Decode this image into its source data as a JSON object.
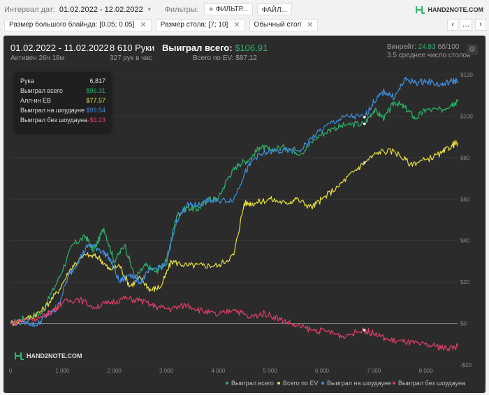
{
  "toolbar": {
    "date_label": "Интервал дат:",
    "date_value": "01.02.2022 - 12.02.2022",
    "filters_label": "Фильтры:",
    "filters_button": "ФИЛЬТР...",
    "file_button": "ФАЙЛ...",
    "logo_text": "HAND2NOTE.COM"
  },
  "chips": [
    "Размер большого блайнда: [0.05; 0.05]",
    "Размер стола: [7; 10]",
    "Обычный стол"
  ],
  "nav": {
    "prev": "‹",
    "more": "…",
    "next": "›"
  },
  "header": {
    "date_range": "01.02.2022 - 11.02.2022",
    "active": "Активен 26ч 18м",
    "hands": "8 610 Руки",
    "hands_per_hour": "327 рук в час",
    "won_label": "Выиграл всего:",
    "won_value": "$106.91",
    "ev_text": "Всего по EV: $87.12",
    "winrate_label": "Винрейт:",
    "winrate_value": "24.83",
    "winrate_unit": "бб/100",
    "avg_tables": "3.5 среднее число столов"
  },
  "tooltip": {
    "rows": [
      {
        "label": "Рука",
        "value": "6,817",
        "color": "#dddddd"
      },
      {
        "label": "Выиграл всего",
        "value": "$96.31",
        "color": "#2db36a"
      },
      {
        "label": "Алл-ин EB",
        "value": "$77.57",
        "color": "#e6e040"
      },
      {
        "label": "Выиграл на шоудауне",
        "value": "$99.54",
        "color": "#3f8fe0"
      },
      {
        "label": "Выиграл без шоудауна",
        "value": "-$3.23",
        "color": "#e0406a"
      }
    ]
  },
  "watermark": "HAND2NOTE.COM",
  "chart_data": {
    "type": "line",
    "xlim": [
      0,
      8610
    ],
    "ylim": [
      -20,
      120
    ],
    "x_ticks": [
      "0",
      "1 000",
      "2 000",
      "3 000",
      "4 000",
      "5 000",
      "6 000",
      "7 000",
      "8 000"
    ],
    "y_ticks": [
      "$120",
      "$100",
      "$80",
      "$60",
      "$40",
      "$20",
      "$0",
      "-$20"
    ],
    "series": [
      {
        "name": "Выиграл всего",
        "color": "#2db36a",
        "points": [
          [
            0,
            0
          ],
          [
            300,
            3
          ],
          [
            600,
            5
          ],
          [
            900,
            20
          ],
          [
            1200,
            38
          ],
          [
            1450,
            42
          ],
          [
            1600,
            35
          ],
          [
            1800,
            46
          ],
          [
            2000,
            30
          ],
          [
            2200,
            38
          ],
          [
            2400,
            22
          ],
          [
            2600,
            28
          ],
          [
            2800,
            25
          ],
          [
            3000,
            30
          ],
          [
            3200,
            52
          ],
          [
            3400,
            56
          ],
          [
            3600,
            55
          ],
          [
            3800,
            60
          ],
          [
            4000,
            60
          ],
          [
            4200,
            71
          ],
          [
            4400,
            77
          ],
          [
            4600,
            79
          ],
          [
            4800,
            85
          ],
          [
            5000,
            84
          ],
          [
            5300,
            85
          ],
          [
            5600,
            82
          ],
          [
            5900,
            90
          ],
          [
            6200,
            94
          ],
          [
            6500,
            96
          ],
          [
            6817,
            96.3
          ],
          [
            7000,
            103
          ],
          [
            7200,
            99
          ],
          [
            7400,
            107
          ],
          [
            7600,
            104
          ],
          [
            7800,
            99
          ],
          [
            8000,
            103
          ],
          [
            8300,
            103
          ],
          [
            8500,
            106
          ],
          [
            8610,
            106.9
          ]
        ]
      },
      {
        "name": "Всего по EV",
        "color": "#e6e040",
        "points": [
          [
            0,
            0
          ],
          [
            300,
            2
          ],
          [
            600,
            6
          ],
          [
            900,
            15
          ],
          [
            1200,
            28
          ],
          [
            1450,
            33
          ],
          [
            1700,
            32
          ],
          [
            1900,
            26
          ],
          [
            2100,
            28
          ],
          [
            2300,
            18
          ],
          [
            2500,
            22
          ],
          [
            2700,
            16
          ],
          [
            2900,
            18
          ],
          [
            3100,
            30
          ],
          [
            3400,
            28
          ],
          [
            3700,
            28
          ],
          [
            4000,
            28
          ],
          [
            4300,
            33
          ],
          [
            4500,
            58
          ],
          [
            4700,
            58
          ],
          [
            5000,
            60
          ],
          [
            5300,
            58
          ],
          [
            5500,
            60
          ],
          [
            5800,
            56
          ],
          [
            6000,
            60
          ],
          [
            6300,
            66
          ],
          [
            6600,
            73
          ],
          [
            6817,
            77.6
          ],
          [
            7100,
            83
          ],
          [
            7400,
            83
          ],
          [
            7700,
            77
          ],
          [
            8000,
            79
          ],
          [
            8300,
            82
          ],
          [
            8500,
            86
          ],
          [
            8610,
            87.1
          ]
        ]
      },
      {
        "name": "Выиграл на шоудауне",
        "color": "#3f8fe0",
        "points": [
          [
            0,
            0
          ],
          [
            300,
            1
          ],
          [
            500,
            -1
          ],
          [
            700,
            4
          ],
          [
            900,
            7
          ],
          [
            1100,
            22
          ],
          [
            1300,
            30
          ],
          [
            1500,
            38
          ],
          [
            1700,
            36
          ],
          [
            1900,
            32
          ],
          [
            2100,
            20
          ],
          [
            2300,
            24
          ],
          [
            2500,
            20
          ],
          [
            2700,
            26
          ],
          [
            3000,
            28
          ],
          [
            3200,
            50
          ],
          [
            3400,
            57
          ],
          [
            3600,
            57
          ],
          [
            3800,
            59
          ],
          [
            4000,
            59
          ],
          [
            4300,
            60
          ],
          [
            4500,
            72
          ],
          [
            4700,
            80
          ],
          [
            5000,
            83
          ],
          [
            5300,
            83
          ],
          [
            5600,
            84
          ],
          [
            5900,
            92
          ],
          [
            6200,
            97
          ],
          [
            6500,
            100
          ],
          [
            6817,
            99.5
          ],
          [
            7000,
            107
          ],
          [
            7200,
            112
          ],
          [
            7400,
            109
          ],
          [
            7600,
            118
          ],
          [
            7800,
            116
          ],
          [
            8000,
            117
          ],
          [
            8300,
            115
          ],
          [
            8500,
            117
          ],
          [
            8610,
            117
          ]
        ]
      },
      {
        "name": "Выиграл без шоудауна",
        "color": "#e0406a",
        "points": [
          [
            0,
            0
          ],
          [
            300,
            2
          ],
          [
            600,
            3
          ],
          [
            800,
            6
          ],
          [
            1000,
            10
          ],
          [
            1300,
            12
          ],
          [
            1600,
            8
          ],
          [
            1900,
            10
          ],
          [
            2200,
            12
          ],
          [
            2500,
            11
          ],
          [
            2800,
            8
          ],
          [
            3100,
            7
          ],
          [
            3400,
            9
          ],
          [
            3700,
            6
          ],
          [
            4000,
            4
          ],
          [
            4300,
            7
          ],
          [
            4600,
            3
          ],
          [
            4900,
            5
          ],
          [
            5200,
            2
          ],
          [
            5500,
            -1
          ],
          [
            5800,
            -3
          ],
          [
            6100,
            -4
          ],
          [
            6400,
            -6
          ],
          [
            6817,
            -3.2
          ],
          [
            7000,
            -5
          ],
          [
            7300,
            -8
          ],
          [
            7600,
            -9
          ],
          [
            7900,
            -10
          ],
          [
            8200,
            -11
          ],
          [
            8400,
            -12
          ],
          [
            8610,
            -11
          ]
        ]
      }
    ],
    "legend": [
      "Выиграл всего",
      "Всего по EV",
      "Выиграл на шоудауне",
      "Выиграл без шоудауна"
    ],
    "legend_position": "bottom-right",
    "grid": true,
    "marker_x": 6817
  }
}
